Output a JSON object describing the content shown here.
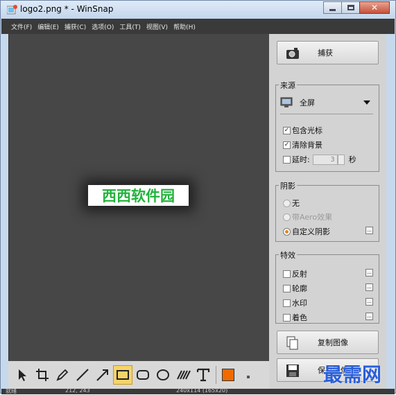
{
  "window": {
    "title": "logo2.png * - WinSnap",
    "close_glyph": "✕"
  },
  "menu": [
    "文件(F)",
    "编辑(E)",
    "捕获(C)",
    "选项(O)",
    "工具(T)",
    "视图(V)",
    "帮助(H)"
  ],
  "canvas": {
    "logo_text": "西西软件园"
  },
  "capture_button": {
    "label": "捕获",
    "icon": "camera-icon"
  },
  "source": {
    "title": "来源",
    "mode": "全屏",
    "include_cursor_label": "包含光标",
    "include_cursor": true,
    "clear_background_label": "清除背景",
    "clear_background": true,
    "delay_label": "延时:",
    "delay": false,
    "delay_value": "3",
    "delay_unit": "秒"
  },
  "shadow": {
    "title": "阴影",
    "options": [
      "无",
      "带Aero效果",
      "自定义阴影"
    ],
    "selected": "自定义阴影",
    "more_glyph": "..."
  },
  "effects": {
    "title": "特效",
    "items": [
      "反射",
      "轮廓",
      "水印",
      "着色"
    ]
  },
  "copy_button": {
    "label": "复制图像",
    "icon": "copy-icon"
  },
  "save_button": {
    "label": "保存图像",
    "icon": "floppy-disk-icon"
  },
  "status": {
    "state": "就绪",
    "coords": "212, 243",
    "size": "240x114 (165x20)"
  },
  "toolbar_tools": [
    "pointer-icon",
    "crop-icon",
    "pen-icon",
    "line-icon",
    "arrow-icon",
    "rectangle-icon",
    "rounded-rectangle-icon",
    "ellipse-icon",
    "hatch-icon",
    "text-icon"
  ],
  "watermark_text": "最需网",
  "colors": {
    "accent_fill": "#f06a00",
    "logo_green": "#21b33b",
    "selected_tool": "#f7d36a"
  }
}
